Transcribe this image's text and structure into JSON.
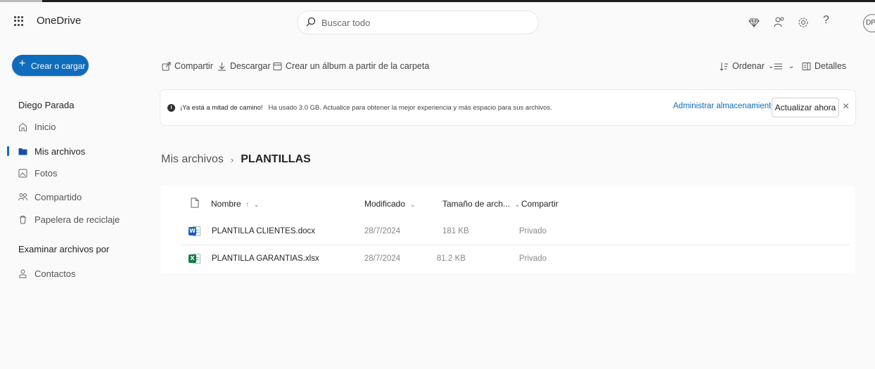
{
  "app": {
    "title": "OneDrive"
  },
  "search": {
    "placeholder": "Buscar todo"
  },
  "header_icons": [
    "diamond-icon",
    "people-icon",
    "settings-icon",
    "help-icon"
  ],
  "header": {
    "help_glyph": "?"
  },
  "user": {
    "initials": "DP",
    "name": "Diego Parada"
  },
  "sidebar": {
    "create_label": "Crear o cargar",
    "items": [
      {
        "label": "Inicio",
        "icon": "home-icon"
      },
      {
        "label": "Mis archivos",
        "icon": "folder-icon",
        "active": true
      },
      {
        "label": "Fotos",
        "icon": "photo-icon"
      },
      {
        "label": "Compartido",
        "icon": "people-icon"
      },
      {
        "label": "Papelera de reciclaje",
        "icon": "trash-icon"
      }
    ],
    "browse_title": "Examinar archivos por",
    "browse_items": [
      {
        "label": "Contactos",
        "icon": "contact-icon"
      }
    ]
  },
  "toolbar": {
    "share": "Compartir",
    "download": "Descargar",
    "album": "Crear un álbum a partir de la carpeta",
    "sort": "Ordenar",
    "details": "Detalles"
  },
  "banner": {
    "bold": "¡Ya está a mitad de camino!",
    "message": "Ha usado 3.0 GB. Actualice para obtener la mejor experiencia y más espacio para sus archivos.",
    "manage": "Administrar almacenamiento",
    "upgrade": "Actualizar ahora",
    "close": "×"
  },
  "breadcrumb": {
    "root": "Mis archivos",
    "separator": "›",
    "current": "PLANTILLAS"
  },
  "table": {
    "headers": {
      "name": "Nombre",
      "modified": "Modificado",
      "size": "Tamaño de arch...",
      "sharing": "Compartir"
    },
    "rows": [
      {
        "name": "PLANTILLA CLIENTES.docx",
        "type": "word",
        "badge": "W",
        "modified": "28/7/2024",
        "size": "181 KB",
        "sharing": "Privado"
      },
      {
        "name": "PLANTILLA GARANTIAS.xlsx",
        "type": "excel",
        "badge": "X",
        "modified": "28/7/2024",
        "size": "81.2 KB",
        "sharing": "Privado"
      }
    ]
  },
  "colors": {
    "accent": "#0f6cbd",
    "word": "#185abd",
    "excel": "#107c41"
  }
}
